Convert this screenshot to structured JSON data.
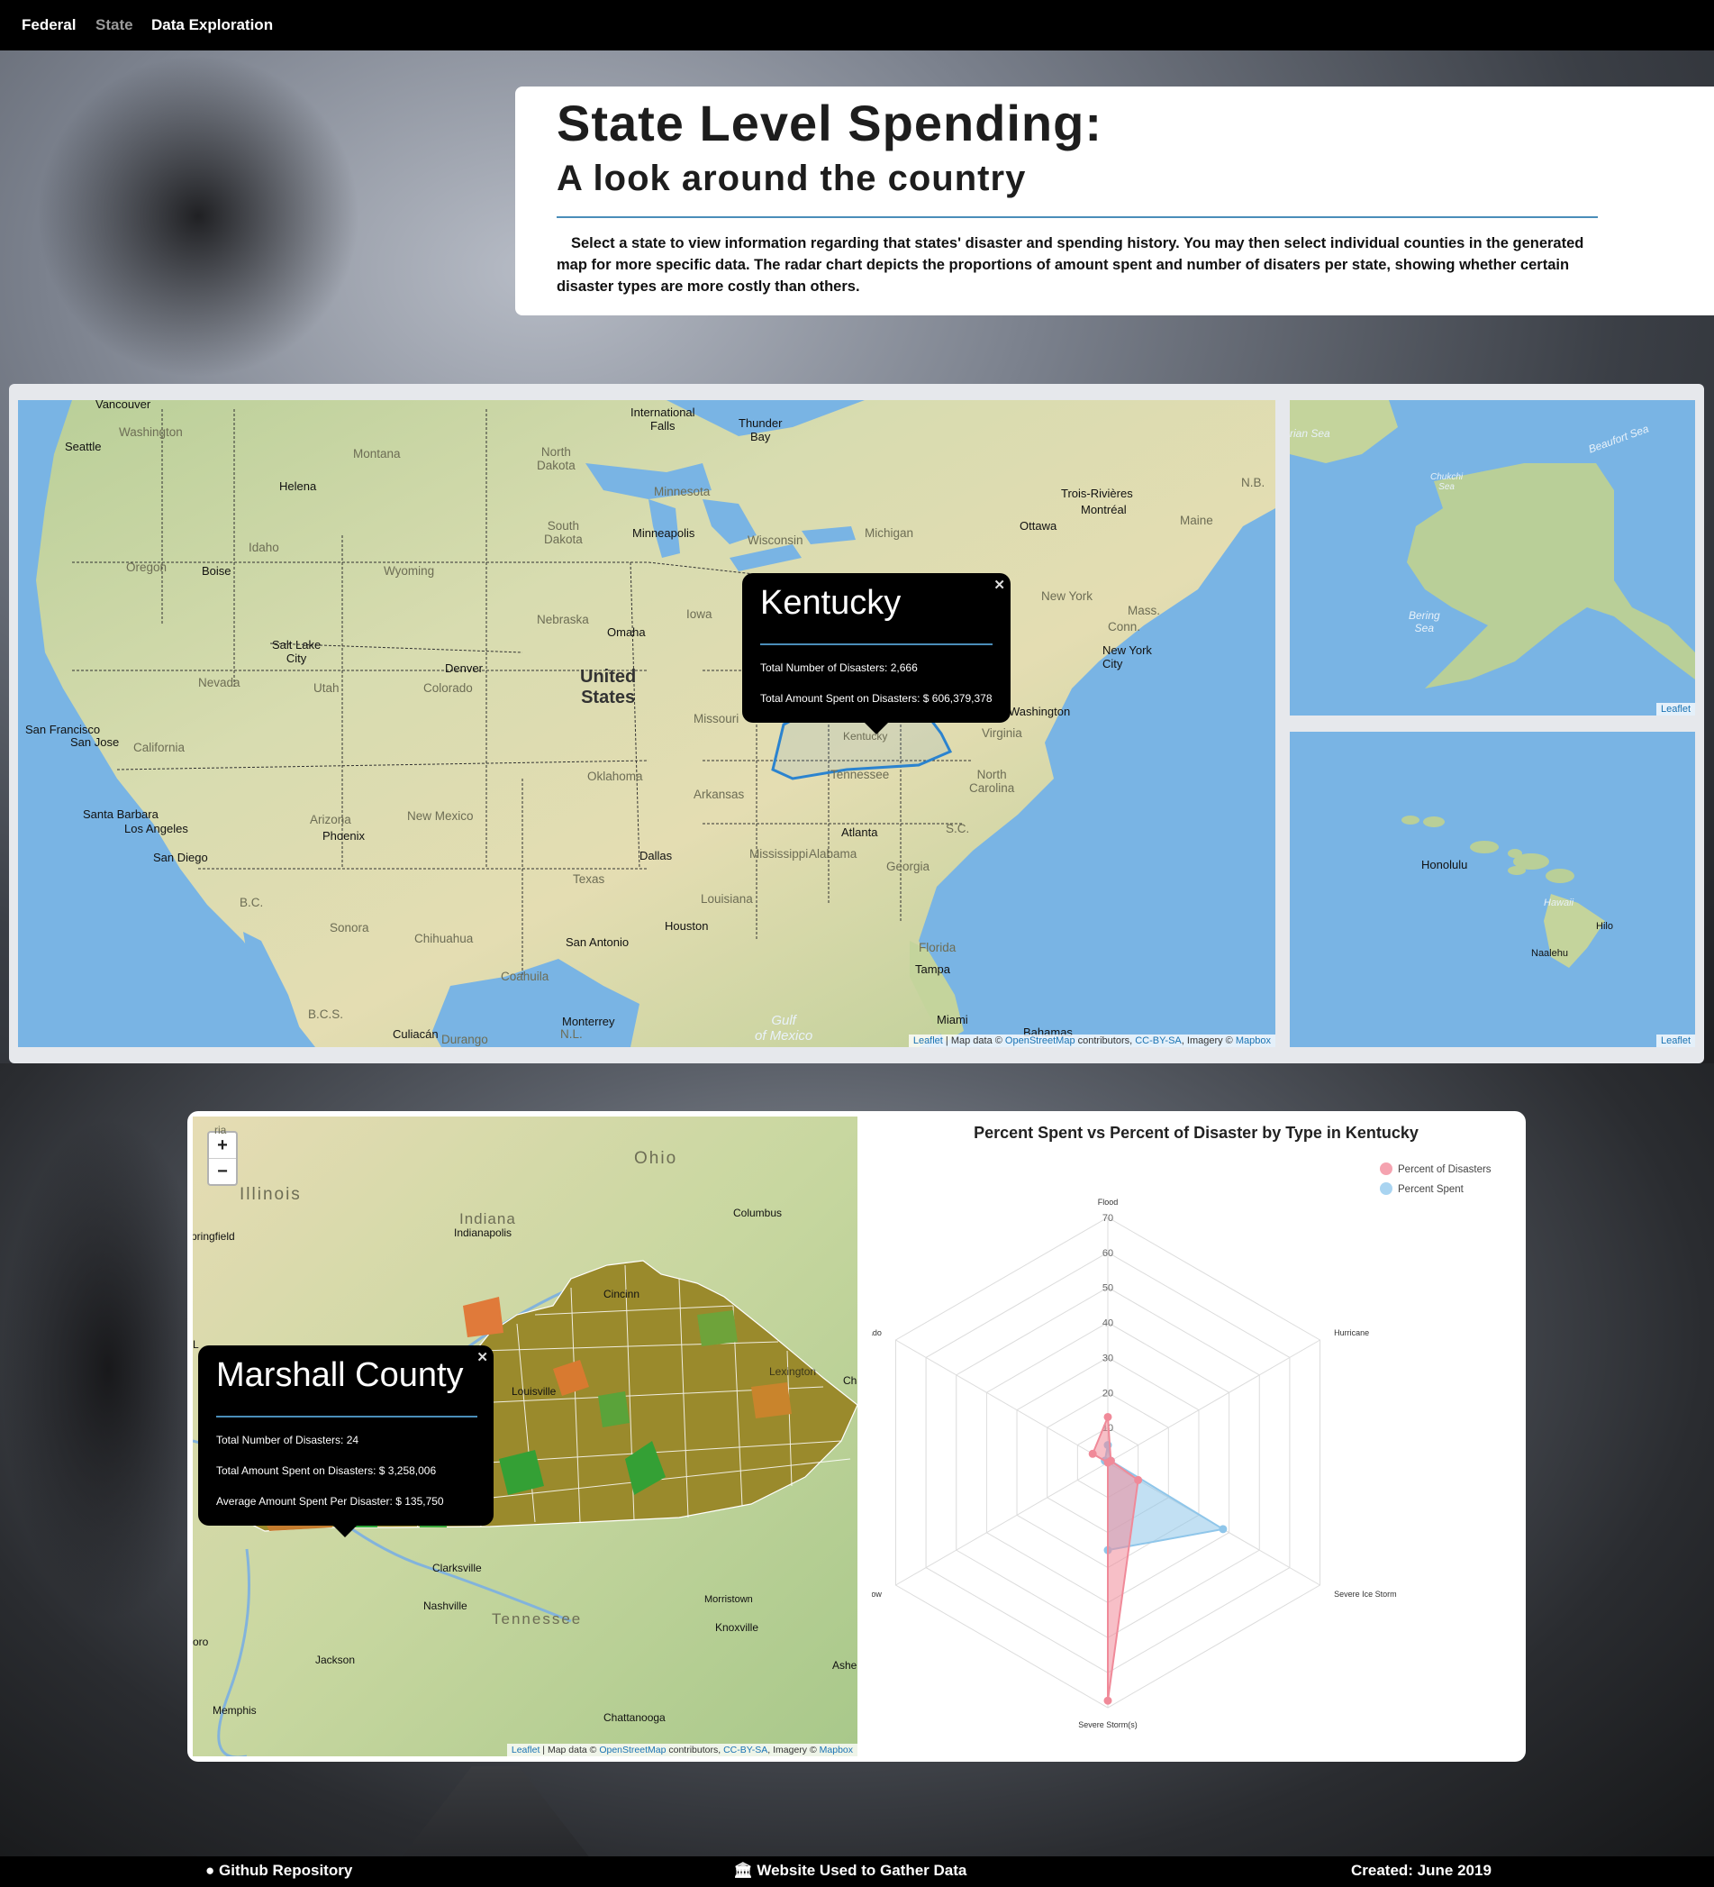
{
  "nav": {
    "items": [
      {
        "label": "Federal",
        "active": false
      },
      {
        "label": "State",
        "active": true
      },
      {
        "label": "Data Exploration",
        "active": false
      }
    ]
  },
  "header": {
    "title": "State Level Spending:",
    "subtitle": "A look around the country",
    "description": "Select a state to view information regarding that states' disaster and spending history. You may then select individual counties in the generated map for more specific data. The radar chart depicts the proportions of amount spent and number of disaters per state, showing whether certain disaster types are more costly than others."
  },
  "state_map": {
    "labels": {
      "vancouver": "Vancouver",
      "washington": "Washington",
      "seattle": "Seattle",
      "montana": "Montana",
      "helena": "Helena",
      "north_dakota": "North\nDakota",
      "minnesota": "Minnesota",
      "international_falls": "International\nFalls",
      "thunder_bay": "Thunder\nBay",
      "oregon": "Oregon",
      "idaho": "Idaho",
      "boise": "Boise",
      "south_dakota": "South\nDakota",
      "wyoming": "Wyoming",
      "minneapolis": "Minneapolis",
      "wisconsin": "Wisconsin",
      "michigan": "Michigan",
      "trois_rivieres": "Trois-Rivières",
      "montreal": "Montréal",
      "ottawa": "Ottawa",
      "maine": "Maine",
      "nb": "N.B.",
      "nebraska": "Nebraska",
      "omaha": "Omaha",
      "iowa": "Iowa",
      "new_york_state": "New York",
      "mass": "Mass.",
      "conn": "Conn.",
      "new_york_city": "New York\nCity",
      "salt_lake_city": "Salt Lake\nCity",
      "nevada": "Nevada",
      "utah": "Utah",
      "denver": "Denver",
      "colorado": "Colorado",
      "united_states": "United\nStates",
      "missouri": "Missouri",
      "washington_dc": "Washington",
      "san_francisco": "San Francisco",
      "san_jose": "San Jose",
      "california": "California",
      "virginia": "Virginia",
      "kentucky_label": "Kentucky",
      "oklahoma": "Oklahoma",
      "arkansas": "Arkansas",
      "tennessee": "Tennessee",
      "north_carolina": "North\nCarolina",
      "santa_barbara": "Santa Barbara",
      "los_angeles": "Los Angeles",
      "arizona": "Arizona",
      "new_mexico": "New Mexico",
      "phoenix": "Phoenix",
      "san_diego": "San Diego",
      "dallas": "Dallas",
      "atlanta": "Atlanta",
      "sc": "S.C.",
      "mississippi": "Mississippi",
      "alabama": "Alabama",
      "georgia": "Georgia",
      "texas": "Texas",
      "louisiana": "Louisiana",
      "bc": "B.C.",
      "sonora": "Sonora",
      "chihuahua": "Chihuahua",
      "san_antonio": "San Antonio",
      "houston": "Houston",
      "coahuila": "Coahuila",
      "tampa": "Tampa",
      "florida": "Florida",
      "bcs": "B.C.S.",
      "culiacan": "Culiacán",
      "durango": "Durango",
      "monterrey": "Monterrey",
      "nl": "N.L.",
      "gulf": "Gulf\nof Mexico",
      "miami": "Miami",
      "bahamas": "Bahamas"
    },
    "attribution": {
      "leaflet": "Leaflet",
      "text1": " | Map data © ",
      "osm": "OpenStreetMap",
      "text2": " contributors, ",
      "cc": "CC-BY-SA",
      "text3": ", Imagery © ",
      "mapbox": "Mapbox"
    },
    "popup": {
      "title": "Kentucky",
      "disasters": "Total Number of Disasters: 2,666",
      "spent": "Total Amount Spent on Disasters: $ 606,379,378"
    }
  },
  "alaska_map": {
    "labels": {
      "chukchi": "Chukchi\nSea",
      "siberian": "rian Sea",
      "beaufort": "Beaufort Sea",
      "bering": "Bering\nSea"
    },
    "attribution": "Leaflet"
  },
  "hawaii_map": {
    "labels": {
      "honolulu": "Honolulu",
      "hawaii": "Hawaii",
      "hilo": "Hilo",
      "naalehu": "Naalehu"
    },
    "attribution": "Leaflet"
  },
  "county_map": {
    "zoom_in": "+",
    "zoom_out": "−",
    "labels": {
      "ohio": "Ohio",
      "illinois": "Illinois",
      "indiana": "Indiana",
      "indianapolis": "Indianapolis",
      "columbus": "Columbus",
      "springfield": "pringfield",
      "cincinnati": "Cincinn",
      "louisville": "Louisville",
      "lexington": "Lexington",
      "clarksville": "Clarksville",
      "nashville": "Nashville",
      "morristown": "Morristown",
      "knoxville": "Knoxville",
      "tennessee": "Tennessee",
      "jackson": "Jackson",
      "memphis": "Memphis",
      "chattanooga": "Chattanooga",
      "cha": "Cha",
      "ashe": "Ashe",
      "oro": "oro",
      "ria": "ria",
      "l": "L"
    },
    "attribution": {
      "leaflet": "Leaflet",
      "text1": " | Map data © ",
      "osm": "OpenStreetMap",
      "text2": " contributors, ",
      "cc": "CC-BY-SA",
      "text3": ", Imagery © ",
      "mapbox": "Mapbox"
    },
    "popup": {
      "title": "Marshall County",
      "disasters": "Total Number of Disasters: 24",
      "spent": "Total Amount Spent on Disasters: $ 3,258,006",
      "average": "Average Amount Spent Per Disaster: $ 135,750"
    }
  },
  "chart_data": {
    "type": "radar",
    "title": "Percent Spent vs Percent of Disaster by Type in Kentucky",
    "categories": [
      "Flood",
      "Hurricane",
      "Severe Ice Storm",
      "Severe Storm(s)",
      "Snow",
      "Tornado"
    ],
    "ticks": [
      10,
      20,
      30,
      40,
      50,
      60,
      70
    ],
    "rmax": 70,
    "legend_position": "top-right",
    "series": [
      {
        "name": "Percent of Disasters",
        "values": [
          13,
          1,
          10,
          68,
          0,
          5
        ],
        "color": "#f08a99"
      },
      {
        "name": "Percent Spent",
        "values": [
          5,
          1,
          38,
          25,
          0,
          1
        ],
        "color": "#8fc6ea"
      }
    ]
  },
  "footer": {
    "github": "Github Repository",
    "website": "Website Used to Gather Data",
    "created": "Created: June 2019"
  }
}
